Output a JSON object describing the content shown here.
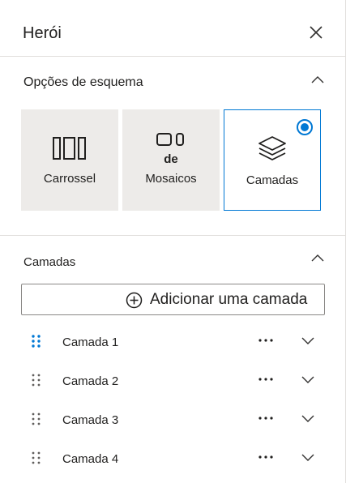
{
  "panel": {
    "title": "Herói",
    "close_icon": "close-icon"
  },
  "layout_options": {
    "title": "Opções de esquema",
    "collapse_icon": "chevron-up-icon",
    "options": [
      {
        "label": "Carrossel",
        "icon": "carousel-icon",
        "selected": false
      },
      {
        "label_line1": "de",
        "label_line2": "Mosaicos",
        "icon": "tiles-icon",
        "selected": false
      },
      {
        "label": "Camadas",
        "icon": "layers-icon",
        "selected": true
      }
    ]
  },
  "layers": {
    "title": "Camadas",
    "collapse_icon": "chevron-up-icon",
    "add_label": "Adicionar uma camada",
    "items": [
      {
        "label": "Camada 1"
      },
      {
        "label": "Camada 2"
      },
      {
        "label": "Camada 3"
      },
      {
        "label": "Camada 4"
      }
    ]
  },
  "colors": {
    "accent": "#0078d4",
    "card_bg": "#edebe9",
    "divider": "#e1dfdd",
    "text": "#201f1e"
  }
}
